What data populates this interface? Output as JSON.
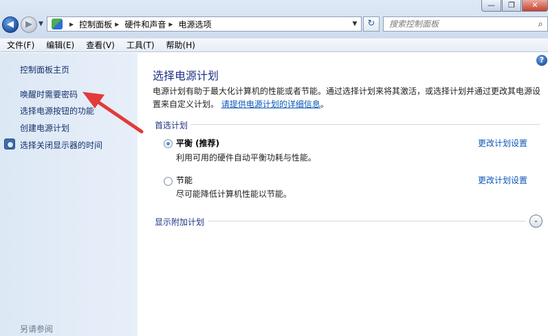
{
  "window_controls": {
    "minimize": "—",
    "maximize": "❐",
    "close": "✕"
  },
  "nav": {
    "back_glyph": "◀",
    "forward_glyph": "▶",
    "recent_glyph": "▼"
  },
  "address": {
    "breadcrumbs": [
      "控制面板",
      "硬件和声音",
      "电源选项"
    ],
    "separator": "▶",
    "dropdown_glyph": "▼",
    "icon": "control-panel-icon"
  },
  "refresh_glyph": "↻",
  "search": {
    "placeholder": "搜索控制面板",
    "icon": "search-icon",
    "glyph": "⌕"
  },
  "menu": [
    "文件(F)",
    "编辑(E)",
    "查看(V)",
    "工具(T)",
    "帮助(H)"
  ],
  "left_pane": {
    "home": "控制面板主页",
    "links": [
      "唤醒时需要密码",
      "选择电源按钮的功能",
      "创建电源计划",
      "选择关闭显示器的时间"
    ],
    "see_also": "另请参阅"
  },
  "main": {
    "help_glyph": "?",
    "title": "选择电源计划",
    "description": "电源计划有助于最大化计算机的性能或者节能。通过选择计划来将其激活，或选择计划并通过更改其电源设置来自定义计划。",
    "description_link": "请提供电源计划的详细信息",
    "description_end": "。",
    "preferred_group": "首选计划",
    "plans": [
      {
        "name": "平衡 (推荐)",
        "desc": "利用可用的硬件自动平衡功耗与性能。",
        "link": "更改计划设置",
        "selected": true
      },
      {
        "name": "节能",
        "desc": "尽可能降低计算机性能以节能。",
        "link": "更改计划设置",
        "selected": false
      }
    ],
    "more_plans": "显示附加计划",
    "expand_glyph": "⌄"
  },
  "colors": {
    "annotation_arrow": "#e33a3a",
    "link": "#0a56b8",
    "heading": "#1e3287"
  }
}
